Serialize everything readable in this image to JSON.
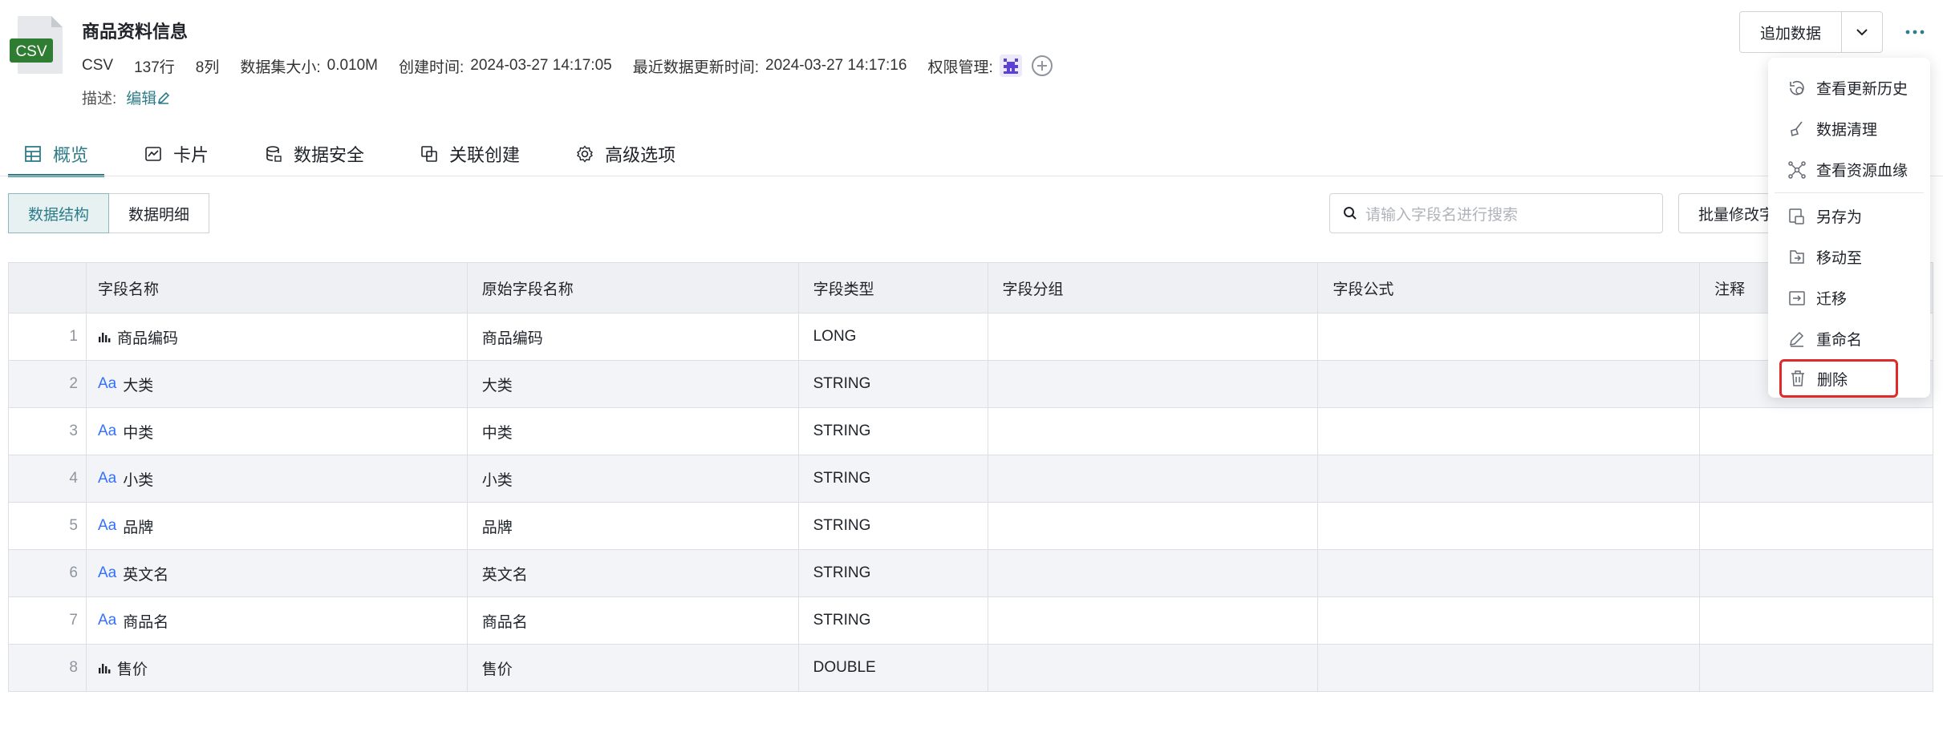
{
  "header": {
    "file_badge": "CSV",
    "title": "商品资料信息",
    "meta": {
      "format": "CSV",
      "rows": "137行",
      "cols": "8列",
      "size_label": "数据集大小:",
      "size_value": "0.010M",
      "created_label": "创建时间:",
      "created_value": "2024-03-27 14:17:05",
      "updated_label": "最近数据更新时间:",
      "updated_value": "2024-03-27 14:17:16",
      "permission_label": "权限管理:"
    },
    "desc_label": "描述:",
    "edit_label": "编辑"
  },
  "actions": {
    "append_label": "追加数据",
    "more_icon": "more-icon"
  },
  "tabs": [
    {
      "label": "概览",
      "icon": "table-icon"
    },
    {
      "label": "卡片",
      "icon": "line-chart-icon"
    },
    {
      "label": "数据安全",
      "icon": "database-lock-icon"
    },
    {
      "label": "关联创建",
      "icon": "link-copy-icon"
    },
    {
      "label": "高级选项",
      "icon": "gear-icon"
    }
  ],
  "view_switch": {
    "structure_label": "数据结构",
    "detail_label": "数据明细"
  },
  "search": {
    "placeholder": "请输入字段名进行搜索"
  },
  "batch_label": "批量修改字",
  "table": {
    "columns": [
      "",
      "字段名称",
      "原始字段名称",
      "字段类型",
      "字段分组",
      "字段公式",
      "注释"
    ],
    "rows": [
      {
        "no": "1",
        "name": "商品编码",
        "original": "商品编码",
        "type": "LONG",
        "kind": "measure"
      },
      {
        "no": "2",
        "name": "大类",
        "original": "大类",
        "type": "STRING",
        "kind": "text"
      },
      {
        "no": "3",
        "name": "中类",
        "original": "中类",
        "type": "STRING",
        "kind": "text"
      },
      {
        "no": "4",
        "name": "小类",
        "original": "小类",
        "type": "STRING",
        "kind": "text"
      },
      {
        "no": "5",
        "name": "品牌",
        "original": "品牌",
        "type": "STRING",
        "kind": "text"
      },
      {
        "no": "6",
        "name": "英文名",
        "original": "英文名",
        "type": "STRING",
        "kind": "text"
      },
      {
        "no": "7",
        "name": "商品名",
        "original": "商品名",
        "type": "STRING",
        "kind": "text"
      },
      {
        "no": "8",
        "name": "售价",
        "original": "售价",
        "type": "DOUBLE",
        "kind": "measure"
      }
    ],
    "text_type_glyph": "Aa"
  },
  "menu": {
    "items": [
      {
        "label": "查看更新历史",
        "icon": "history-icon"
      },
      {
        "label": "数据清理",
        "icon": "broom-icon"
      },
      {
        "label": "查看资源血缘",
        "icon": "lineage-icon"
      },
      {
        "label": "另存为",
        "icon": "save-as-icon"
      },
      {
        "label": "移动至",
        "icon": "move-icon"
      },
      {
        "label": "迁移",
        "icon": "migrate-icon"
      },
      {
        "label": "重命名",
        "icon": "rename-icon"
      },
      {
        "label": "删除",
        "icon": "trash-icon"
      }
    ]
  },
  "colors": {
    "accent": "#2d7d8a",
    "csv_badge": "#2e7d32",
    "text_type_icon": "#3370ff",
    "highlight_border": "#e02a2a"
  }
}
